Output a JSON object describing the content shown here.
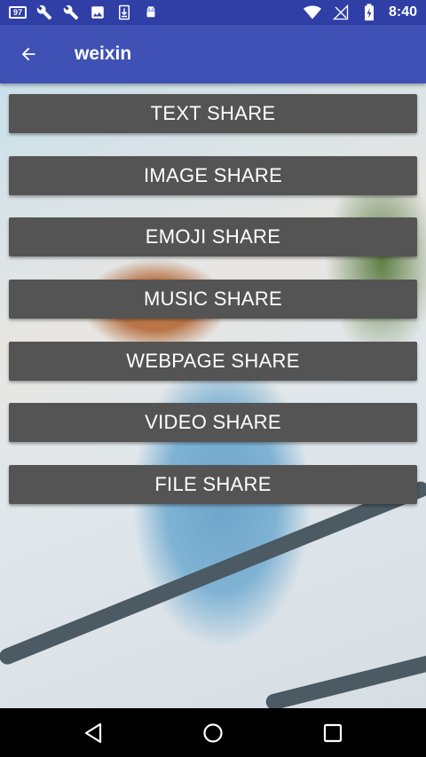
{
  "status_bar": {
    "notification_count": "97",
    "time": "8:40",
    "left_icons": [
      "notification-count-icon",
      "wrench-icon",
      "wrench-icon",
      "image-icon",
      "download-icon",
      "android-icon"
    ],
    "right_icons": [
      "wifi-icon",
      "signal-off-icon",
      "battery-charging-icon"
    ]
  },
  "toolbar": {
    "title": "weixin",
    "back_icon": "arrow-left-icon"
  },
  "buttons": [
    {
      "label": "TEXT SHARE"
    },
    {
      "label": "IMAGE SHARE"
    },
    {
      "label": "EMOJI SHARE"
    },
    {
      "label": "MUSIC SHARE"
    },
    {
      "label": "WEBPAGE SHARE"
    },
    {
      "label": "VIDEO SHARE"
    },
    {
      "label": "FILE SHARE"
    }
  ],
  "nav_bar": {
    "icons": [
      "back-triangle-icon",
      "home-circle-icon",
      "recents-square-icon"
    ]
  },
  "colors": {
    "status_bar": "#2f3fa6",
    "toolbar": "#3f51b5",
    "button": "#545454",
    "nav_bar": "#000000"
  }
}
